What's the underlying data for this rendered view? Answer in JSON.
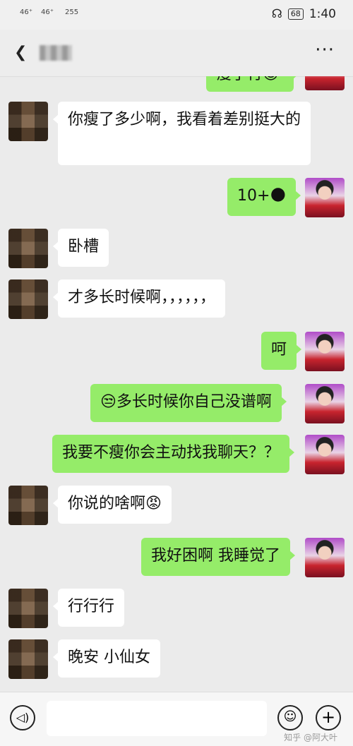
{
  "status_bar": {
    "signal_1": "46⁺",
    "signal_2": "46⁺",
    "speed": "255",
    "battery": "68",
    "time": "1:40",
    "headphone_icon": "headphone-icon"
  },
  "header": {
    "back_icon": "back-arrow-icon",
    "more_icon": "more-dots-icon",
    "more_label": "···"
  },
  "messages": [
    {
      "side": "right",
      "text": "瘦了行😊"
    },
    {
      "side": "left",
      "text": "你瘦了多少啊，我看着差别挺大的"
    },
    {
      "side": "right",
      "text": "10+🌑"
    },
    {
      "side": "left",
      "text": "卧槽"
    },
    {
      "side": "left",
      "text": "才多长时候啊，，，，，，"
    },
    {
      "side": "right",
      "text": "呵"
    },
    {
      "side": "right",
      "text": "😒多长时候你自己没谱啊"
    },
    {
      "side": "right",
      "text": "我要不瘦你会主动找我聊天？？"
    },
    {
      "side": "left",
      "text": "你说的啥啊😡"
    },
    {
      "side": "right",
      "text": "我好困啊 我睡觉了"
    },
    {
      "side": "left",
      "text": "行行行"
    },
    {
      "side": "left",
      "text": "晚安  小仙女"
    }
  ],
  "input_bar": {
    "voice_icon": "voice-icon",
    "voice_glyph": "◁)",
    "emoji_icon": "emoji-icon",
    "emoji_glyph": "☺",
    "plus_icon": "plus-icon",
    "plus_glyph": "+",
    "text_value": ""
  },
  "watermark": "知乎 @阿大叶",
  "colors": {
    "sent_bubble": "#95ec69",
    "received_bubble": "#ffffff",
    "chat_background": "#ebebeb"
  }
}
